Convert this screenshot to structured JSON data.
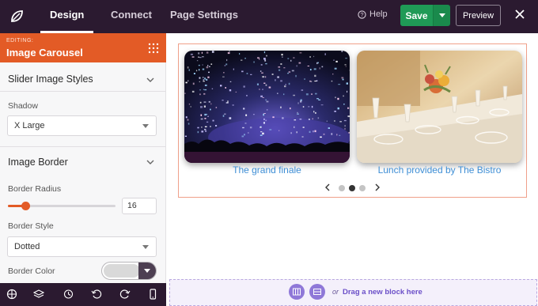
{
  "topbar": {
    "tabs": [
      {
        "label": "Design",
        "active": true
      },
      {
        "label": "Connect",
        "active": false
      },
      {
        "label": "Page Settings",
        "active": false
      }
    ],
    "help_label": "Help",
    "save_label": "Save",
    "preview_label": "Preview",
    "colors": {
      "bar": "#2b1a30",
      "save": "#1f9a56"
    }
  },
  "sidebar": {
    "editing_label": "EDITING:",
    "editing_title": "Image Carousel",
    "sections": {
      "slider_styles": "Slider Image Styles",
      "image_border": "Image Border"
    },
    "shadow": {
      "label": "Shadow",
      "value": "X Large"
    },
    "border_radius": {
      "label": "Border Radius",
      "value": "16",
      "slider_fraction": 0.16
    },
    "border_style": {
      "label": "Border Style",
      "value": "Dotted"
    },
    "border_color": {
      "label": "Border Color",
      "value": "#d9d9d9"
    },
    "accent": "#e35b26",
    "bottom_icons": [
      "column-icon",
      "layers-icon",
      "history-icon",
      "undo-icon",
      "redo-icon",
      "mobile-icon"
    ]
  },
  "canvas": {
    "slides": [
      {
        "caption": "The grand finale",
        "image": "confetti-concert-photo"
      },
      {
        "caption": "Lunch provided by The Bistro",
        "image": "dining-table-photo"
      }
    ],
    "pagination": {
      "count": 3,
      "active_index": 1
    },
    "drop_zone": {
      "or_text": "or",
      "text": "Drag a new block here"
    },
    "caption_color": "#3f8fd6"
  }
}
